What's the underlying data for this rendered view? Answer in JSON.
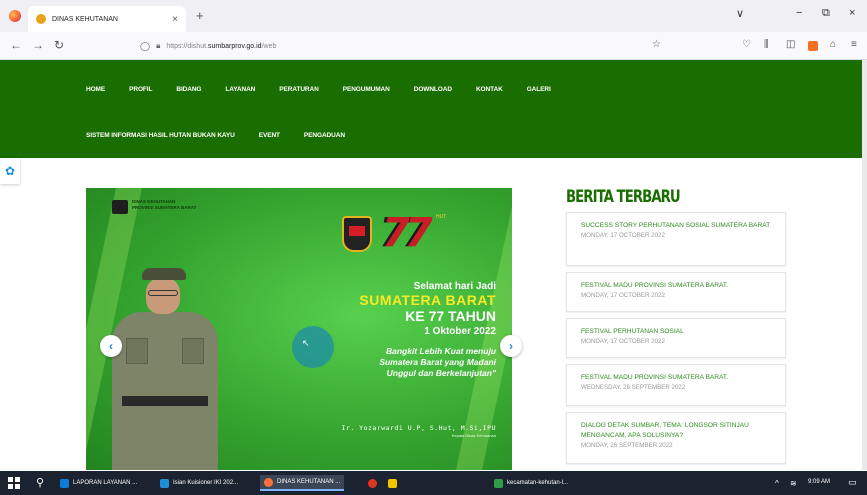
{
  "browser": {
    "tab_title": "DINAS KEHUTANAN",
    "tab_close": "×",
    "new_tab": "+",
    "url_prefix": "https://dishut.",
    "url_domain": "sumbarprov.go.id",
    "url_suffix": "/web",
    "window_controls": {
      "collapse": "∨",
      "minimize": "−",
      "maximize": "⧉",
      "close": "×"
    },
    "nav": {
      "back": "←",
      "forward": "→",
      "reload": "↻"
    }
  },
  "site": {
    "menu_row1": [
      "HOME",
      "PROFIL",
      "BIDANG",
      "LAYANAN",
      "PERATURAN",
      "PENGUMUMAN",
      "DOWNLOAD",
      "KONTAK",
      "GALERI"
    ],
    "menu_row2": [
      "SISTEM INFORMASI HASIL HUTAN BUKAN KAYU",
      "EVENT",
      "PENGADUAN"
    ],
    "brand_color": "#1a6d00"
  },
  "banner": {
    "org_line1": "DINAS KEHUTANAN",
    "org_line2": "PROVINSI SUMATERA BARAT",
    "anniversary": "77",
    "anniversary_sup": "HUT",
    "greet_line1": "Selamat hari Jadi",
    "greet_line2": "SUMATERA BARAT",
    "greet_line3": "KE 77 TAHUN",
    "greet_line4": "1 Oktober 2022",
    "tagline1": "Bangkit Lebih Kuat menuju",
    "tagline2": "Sumatera Barat yang Madani",
    "tagline3": "Unggul dan Berkelanjutan\"",
    "signer": "Ir. Yozarwardi U.P, S.Hut, M.Si,IPU",
    "signer_title": "Kepala Dinas Kehutanan",
    "prev_label": "‹",
    "next_label": "›"
  },
  "news": {
    "title": "BERITA TERBARU",
    "items": [
      {
        "headline": "SUCCESS STORY PERHUTANAN SOSIAL SUMATERA BARAT",
        "date": "MONDAY, 17 OCTOBER 2022"
      },
      {
        "headline": "FESTIVAL MADU PROVINSI SUMATERA BARAT.",
        "date": "MONDAY, 17 OCTOBER 2022"
      },
      {
        "headline": "FESTIVAL PERHUTANAN SOSIAL",
        "date": "MONDAY, 17 OCTOBER 2022"
      },
      {
        "headline": "FESTIVAL MADU PROVINSI SUMATERA BARAT.",
        "date": "WEDNESDAY, 28 SEPTEMBER 2022"
      },
      {
        "headline": "DIALOG DETAK SUMBAR, TEMA: LONGSOR SITINJAU MENGANCAM, APA SOLUSINYA?",
        "date": "MONDAY, 26 SEPTEMBER 2022"
      }
    ]
  },
  "taskbar": {
    "tasks": [
      "LAPORAN LAYANAN ...",
      "Isian Kuisioner IKI 202...",
      "DINAS KEHUTANAN ...",
      "",
      "",
      "kecamatan-kehutan-l..."
    ],
    "time": "9:09 AM"
  }
}
